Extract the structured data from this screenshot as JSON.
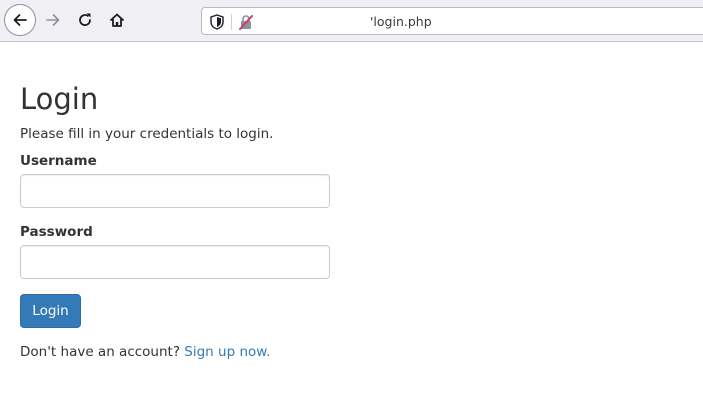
{
  "browser": {
    "url": "'login.php",
    "colors": {
      "toolbar_bg": "#f0f0f4",
      "icon": "#1c1b22",
      "icon_disabled": "#8f8f9d",
      "insecure_icon": "#c93d6e"
    },
    "icons": {
      "back": "arrow-left-icon",
      "forward": "arrow-right-icon",
      "reload": "reload-icon",
      "home": "home-icon",
      "tracking": "shield-icon",
      "security": "insecure-lock-icon"
    },
    "forward_enabled": false
  },
  "page": {
    "title": "Login",
    "subtitle": "Please fill in your credentials to login.",
    "form": {
      "username_label": "Username",
      "username_value": "",
      "password_label": "Password",
      "password_value": "",
      "submit_label": "Login"
    },
    "signup": {
      "prompt": "Don't have an account?",
      "link_text": "Sign up now."
    },
    "colors": {
      "primary": "#337ab7",
      "text": "#333333",
      "input_border": "#cccccc"
    }
  }
}
